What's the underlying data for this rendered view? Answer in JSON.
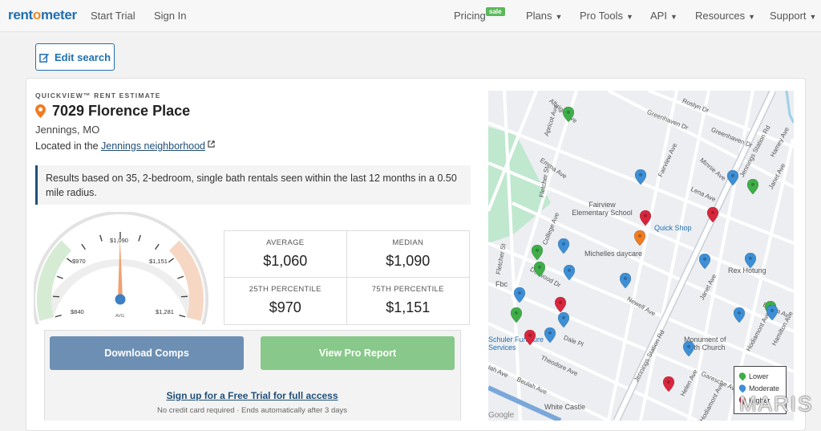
{
  "nav": {
    "logo_pre": "rent",
    "logo_o": "o",
    "logo_post": "meter",
    "start_trial": "Start Trial",
    "sign_in": "Sign In",
    "pricing": "Pricing",
    "sale_badge": "sale",
    "plans": "Plans",
    "pro_tools": "Pro Tools",
    "api": "API",
    "resources": "Resources",
    "support": "Support"
  },
  "edit_label": "Edit search",
  "estimate": {
    "kicker": "QUICKVIEW™ RENT ESTIMATE",
    "address": "7029 Florence Place",
    "city": "Jennings, MO",
    "located_prefix": "Located in the",
    "neighborhood": "Jennings neighborhood",
    "note": "Results based on 35, 2-bedroom, single bath rentals seen within the last 12 months in a 0.50 mile radius."
  },
  "gauge": {
    "labels": [
      "$840",
      "$970",
      "$1,090",
      "$1,151",
      "$1,281"
    ],
    "center_label": "AVG",
    "needle_value": 1060,
    "range": [
      840,
      1281
    ]
  },
  "stats": [
    {
      "label": "AVERAGE",
      "value": "$1,060"
    },
    {
      "label": "MEDIAN",
      "value": "$1,090"
    },
    {
      "label": "25TH PERCENTILE",
      "value": "$970"
    },
    {
      "label": "75TH PERCENTILE",
      "value": "$1,151"
    }
  ],
  "actions": {
    "download": "Download Comps",
    "pro_report": "View Pro Report",
    "trial_link": "Sign up for a Free Trial for full access",
    "no_cc": "No credit card required · Ends automatically after 3 days"
  },
  "map": {
    "streets": [
      "Albright Ave",
      "Apricot Ave",
      "Roslyn Dr",
      "Greenhaven Dr",
      "Greenhaven Dr",
      "Jennings Station Rd",
      "Hamey Ave",
      "Fairview Ave",
      "Minnie Ave",
      "Emma Ave",
      "Lena Ave",
      "Janet Ave",
      "Fletcher St",
      "College Ave",
      "Fletcher St",
      "Jennings Station Rd",
      "Janet Ave",
      "Dorwood Dr",
      "Dale Pl",
      "Theodore Ave",
      "Beulah Ave",
      "Iah Ave",
      "Hodiamont Ave",
      "Hamilton Ave",
      "Helen Ave",
      "Garesche Ave",
      "Hodiamont Ave",
      "Newell Ave",
      "Emma Av"
    ],
    "pois": [
      "Fairview Elementary School",
      "Quick Shop",
      "Michelles daycare",
      "Rex Hotung",
      "Fbc",
      "Monument of Faith Church",
      "Schuler Furniture Services",
      "White Castle",
      "Google"
    ],
    "legend": [
      "Lower",
      "Moderate",
      "Higher"
    ],
    "colors": {
      "lower": "#3fae49",
      "moderate": "#3d8fd6",
      "higher": "#d7263d",
      "subject": "#f07c22"
    }
  },
  "watermark": "MARIS"
}
